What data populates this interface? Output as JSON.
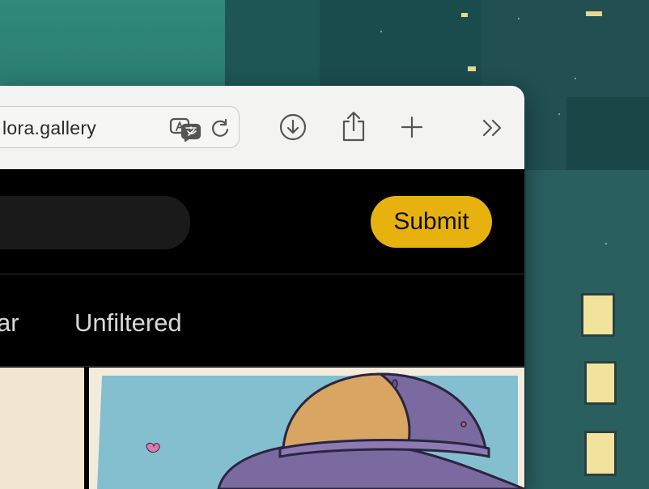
{
  "browser": {
    "url_text": "lora.gallery",
    "icons": {
      "translate": "translate-icon",
      "reload": "reload-icon",
      "download": "download-icon",
      "share": "share-icon",
      "new_tab": "plus-icon",
      "more": "chevron-double-right-icon"
    }
  },
  "header": {
    "search_placeholder": "",
    "submit_label": "Submit",
    "accent_color": "#e8b20e"
  },
  "nav": {
    "tabs": [
      {
        "label": "ar"
      },
      {
        "label": "Unfiltered"
      }
    ]
  }
}
